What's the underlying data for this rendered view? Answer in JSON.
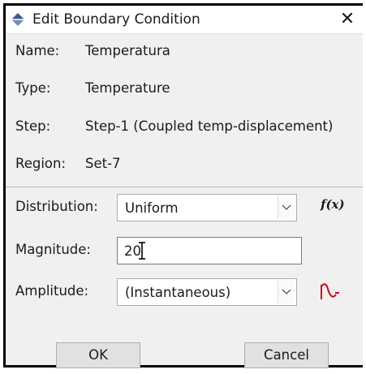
{
  "dialog": {
    "title": "Edit Boundary Condition",
    "close_glyph": "✕"
  },
  "info": {
    "name_label": "Name:",
    "name_value": "Temperatura",
    "type_label": "Type:",
    "type_value": "Temperature",
    "step_label": "Step:",
    "step_value": "Step-1 (Coupled temp-displacement)",
    "region_label": "Region:",
    "region_value": "Set-7"
  },
  "form": {
    "distribution_label": "Distribution:",
    "distribution_value": "Uniform",
    "fx_label": "f(x)",
    "magnitude_label": "Magnitude:",
    "magnitude_value": "20",
    "amplitude_label": "Amplitude:",
    "amplitude_value": "(Instantaneous)"
  },
  "buttons": {
    "ok_label": "OK",
    "cancel_label": "Cancel"
  },
  "icons": {
    "title": "boundary-condition-icon",
    "dropdown": "chevron-down-icon",
    "fx": "function-icon",
    "amplitude": "amplitude-wave-icon"
  },
  "colors": {
    "title_icon": "#3c5a8c",
    "amplitude_icon": "#d0021b",
    "dialog_bg": "#f0f0f0"
  }
}
